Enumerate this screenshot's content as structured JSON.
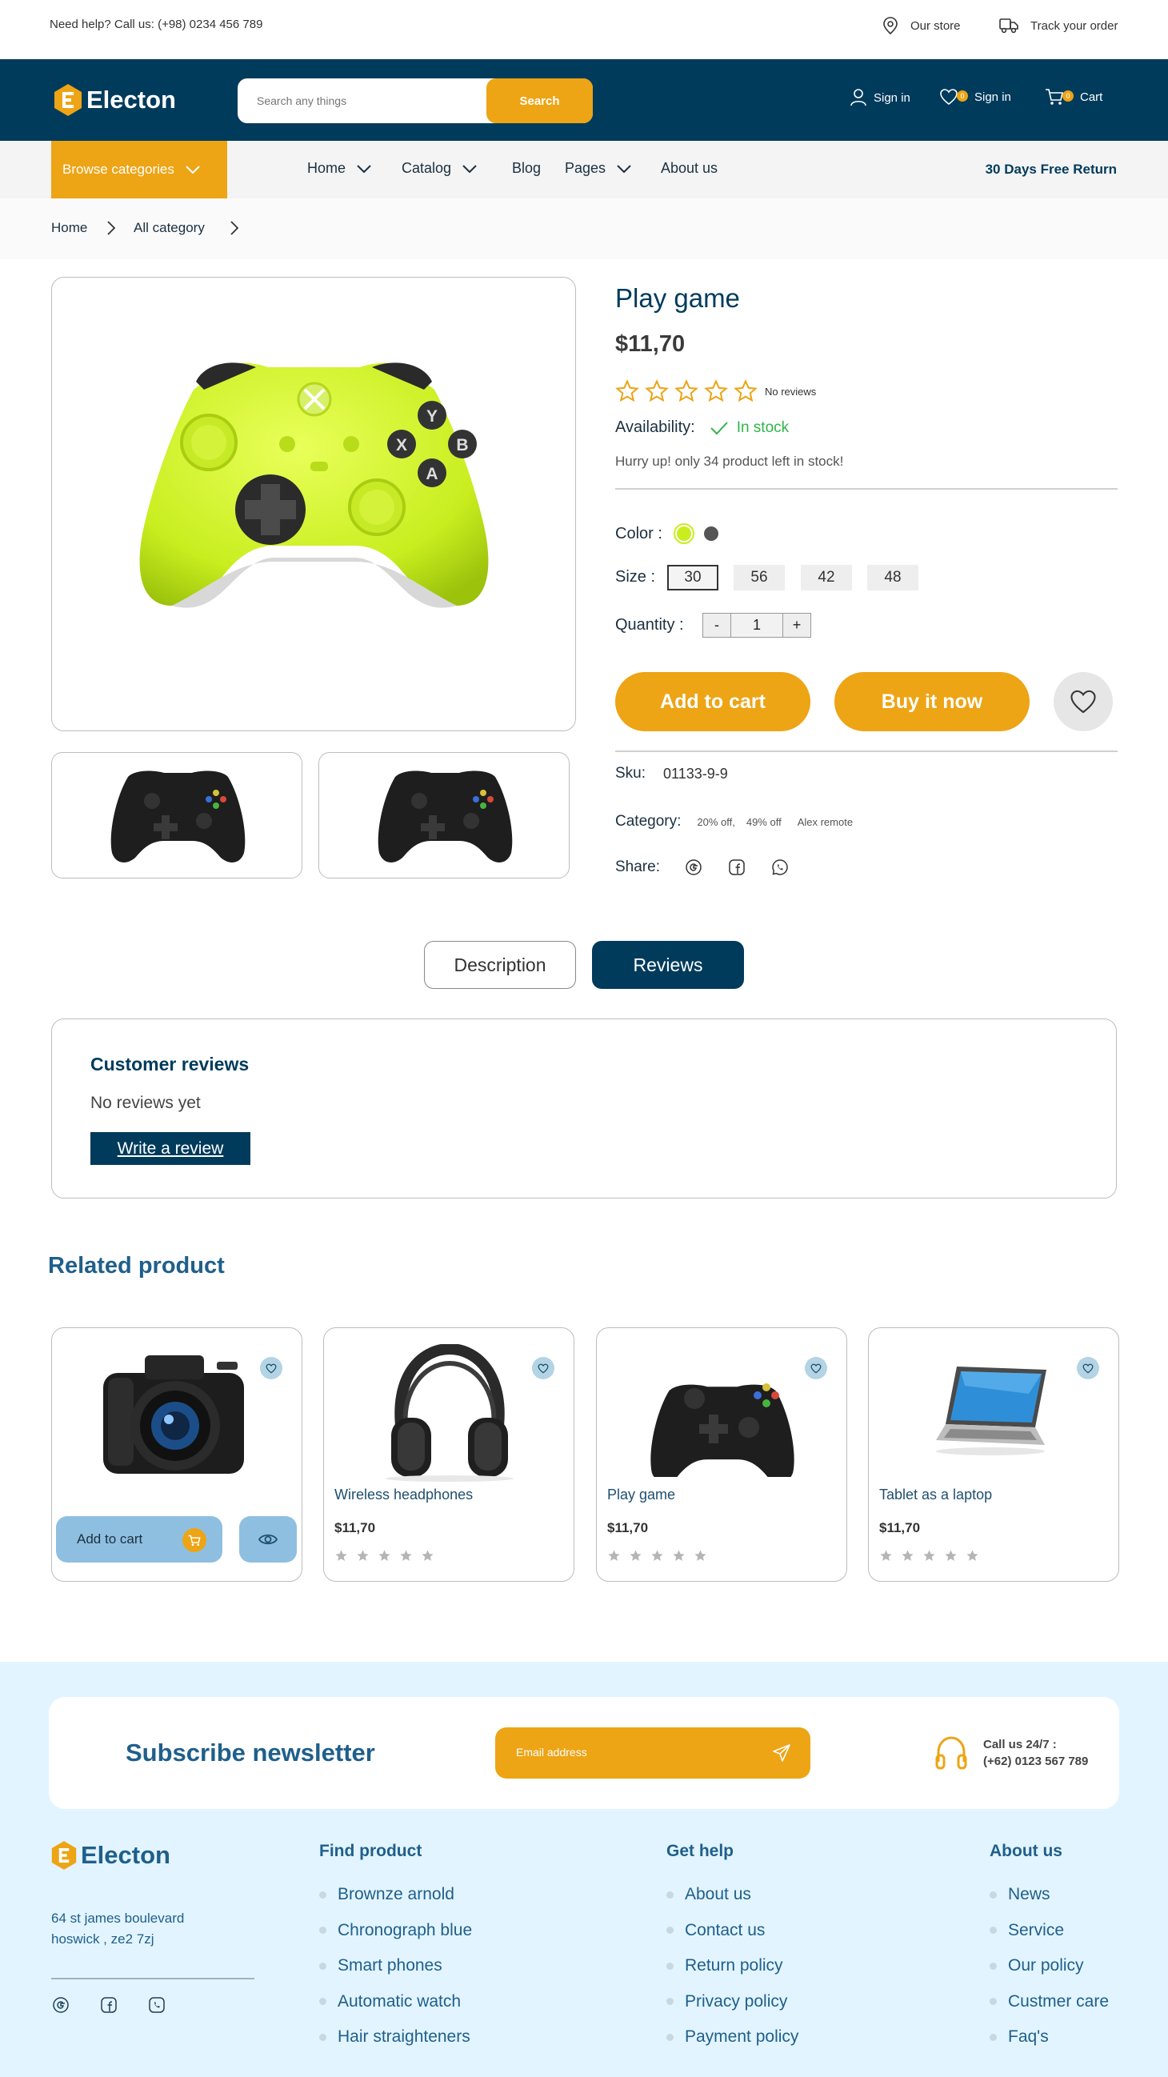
{
  "topbar": {
    "help": "Need help? Call us: (+98) 0234 456 789",
    "store": "Our store",
    "track": "Track your order"
  },
  "header": {
    "brand": "Electon",
    "search_placeholder": "Search any things",
    "search_button": "Search",
    "signin_label": "Sign in",
    "wishlist_label": "Sign in",
    "wishlist_count": "0",
    "cart_label": "Cart",
    "cart_count": "0",
    "accent_color": "#eda415",
    "primary_color": "#003b5c"
  },
  "nav": {
    "browse": "Browse categories",
    "items": [
      "Home",
      "Catalog",
      "Blog",
      "Pages",
      "About us"
    ],
    "free_return": "30 Days Free Return"
  },
  "breadcrumb": [
    "Home",
    "All category"
  ],
  "product": {
    "title": "Play game",
    "price": "$11,70",
    "rating": 0,
    "reviews_text": "No reviews",
    "availability_label": "Availability:",
    "availability_value": "In stock",
    "hurry": "Hurry up! only 34 product left in stock!",
    "color_label": "Color :",
    "colors": [
      "#c8ee1f",
      "#555555"
    ],
    "size_label": "Size :",
    "sizes": [
      "30",
      "56",
      "42",
      "48"
    ],
    "selected_size": "30",
    "quantity_label": "Quantity :",
    "qty_minus": "-",
    "qty_value": "1",
    "qty_plus": "+",
    "add_to_cart": "Add to cart",
    "buy_now": "Buy it now",
    "sku_label": "Sku:",
    "sku_value": "01133-9-9",
    "category_label": "Category:",
    "categories": [
      "20% off,",
      "49% off",
      "Alex remote"
    ],
    "share_label": "Share:",
    "share_icons": [
      "google-icon",
      "facebook-icon",
      "whatsapp-icon"
    ]
  },
  "tabs": {
    "description": "Description",
    "reviews": "Reviews",
    "active": "Reviews"
  },
  "reviews": {
    "title": "Customer reviews",
    "empty": "No reviews yet",
    "write": "Write a review"
  },
  "related": {
    "title": "Related product",
    "add_to_cart": "Add to cart",
    "products": [
      {
        "name": "",
        "price": "",
        "image": "camera"
      },
      {
        "name": "Wireless headphones",
        "price": "$11,70",
        "image": "headphones"
      },
      {
        "name": "Play game",
        "price": "$11,70",
        "image": "controller"
      },
      {
        "name": "Tablet as a laptop",
        "price": "$11,70",
        "image": "laptop"
      }
    ]
  },
  "footer": {
    "newsletter_title": "Subscribe newsletter",
    "email_placeholder": "Email address",
    "call_line1": "Call us 24/7 :",
    "call_line2": "(+62) 0123 567 789",
    "brand": "Electon",
    "address_line1": "64 st james boulevard",
    "address_line2": "hoswick , ze2 7zj",
    "find_product": {
      "title": "Find product",
      "items": [
        "Brownze arnold",
        "Chronograph blue",
        "Smart phones",
        "Automatic watch",
        "Hair straighteners"
      ]
    },
    "get_help": {
      "title": "Get help",
      "items": [
        "About us",
        "Contact us",
        "Return policy",
        "Privacy policy",
        "Payment policy"
      ]
    },
    "about_us": {
      "title": "About us",
      "items": [
        "News",
        "Service",
        "Our policy",
        "Custmer care",
        "Faq's"
      ]
    }
  }
}
